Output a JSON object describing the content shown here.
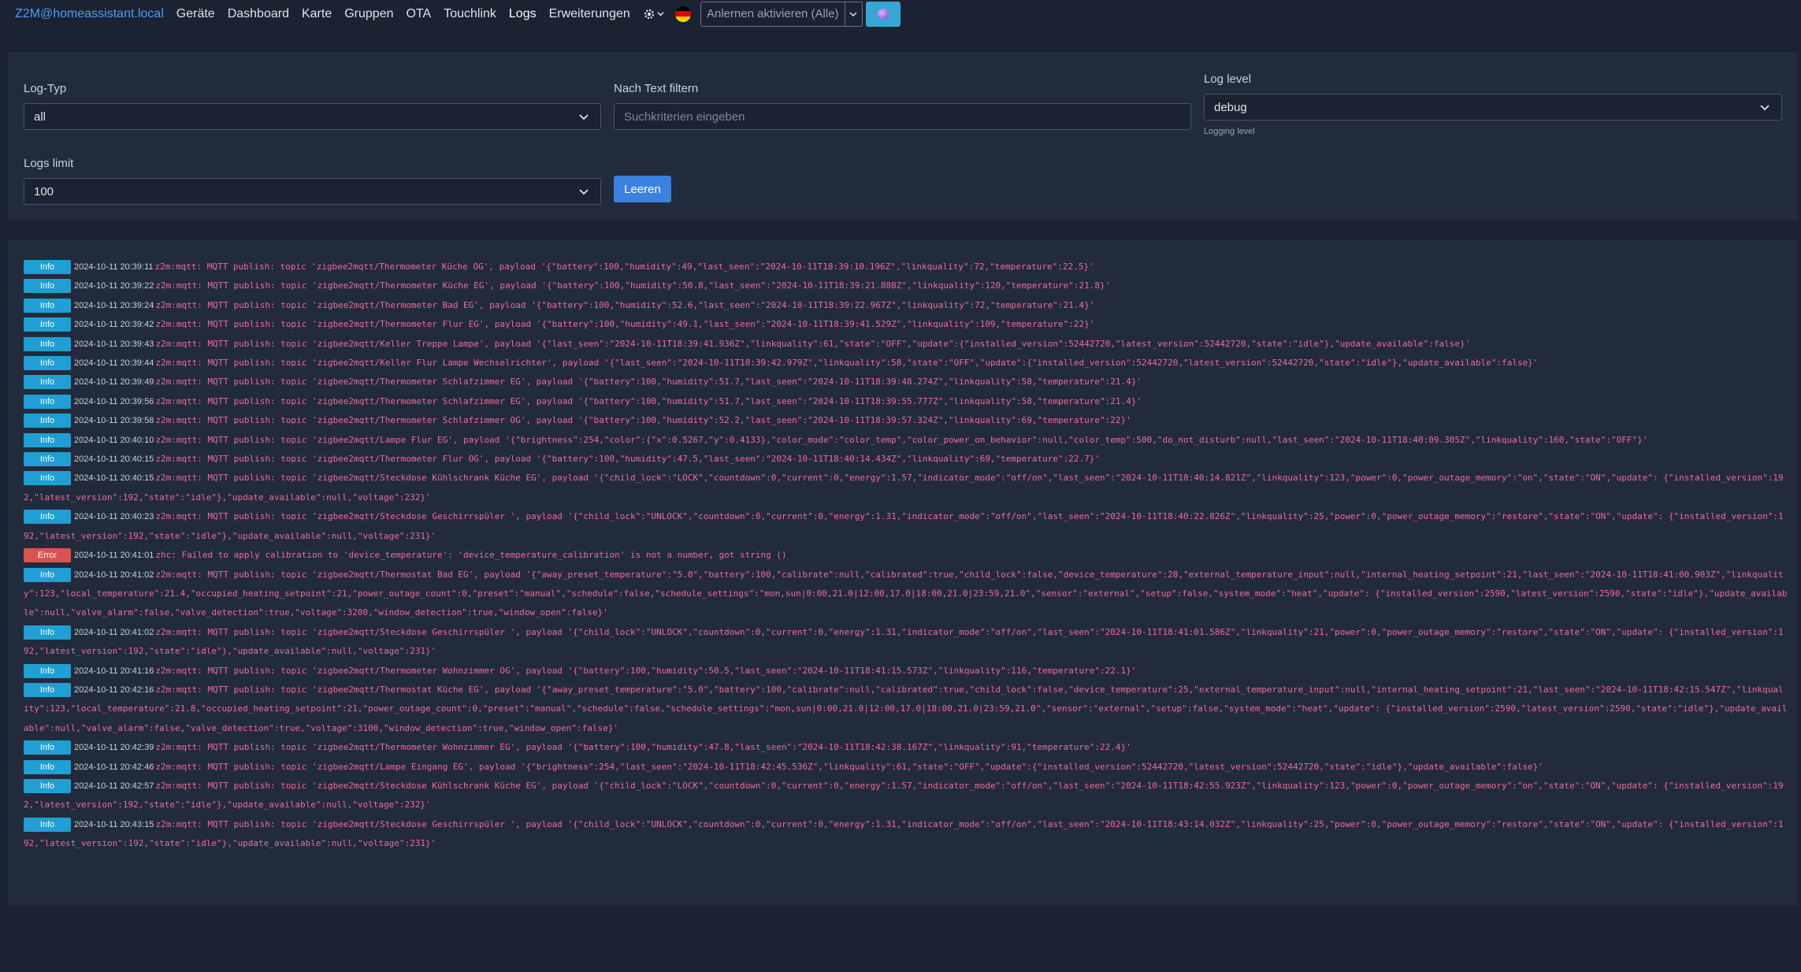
{
  "navbar": {
    "brand": "Z2M@homeassistant.local",
    "links": [
      "Geräte",
      "Dashboard",
      "Karte",
      "Gruppen",
      "OTA",
      "Touchlink",
      "Logs",
      "Erweiterungen"
    ],
    "active": "Logs",
    "pair_button": "Anlernen aktivieren (Alle)",
    "icons": [
      "gear-icon",
      "chevron-down-icon",
      "german-flag-icon",
      "theme-icon"
    ]
  },
  "filters": {
    "log_type_label": "Log-Typ",
    "log_type_value": "all",
    "text_filter_label": "Nach Text filtern",
    "text_filter_placeholder": "Suchkriterien eingeben",
    "log_level_label": "Log level",
    "log_level_value": "debug",
    "log_level_help": "Logging level",
    "logs_limit_label": "Logs limit",
    "logs_limit_value": "100",
    "clear_button": "Leeren"
  },
  "colors": {
    "info_badge": "#1f9fd4",
    "error_badge": "#d9534f",
    "log_text": "#f06a9d",
    "accent": "#3b82e0"
  },
  "logs": [
    {
      "level": "Info",
      "time": "2024-10-11 20:39:11",
      "message": "z2m:mqtt: MQTT publish: topic 'zigbee2mqtt/Thermometer Küche OG', payload '{\"battery\":100,\"humidity\":49,\"last_seen\":\"2024-10-11T18:39:10.196Z\",\"linkquality\":72,\"temperature\":22.5}'"
    },
    {
      "level": "Info",
      "time": "2024-10-11 20:39:22",
      "message": "z2m:mqtt: MQTT publish: topic 'zigbee2mqtt/Thermometer Küche EG', payload '{\"battery\":100,\"humidity\":50.8,\"last_seen\":\"2024-10-11T18:39:21.888Z\",\"linkquality\":120,\"temperature\":21.8}'"
    },
    {
      "level": "Info",
      "time": "2024-10-11 20:39:24",
      "message": "z2m:mqtt: MQTT publish: topic 'zigbee2mqtt/Thermometer Bad EG', payload '{\"battery\":100,\"humidity\":52.6,\"last_seen\":\"2024-10-11T18:39:22.967Z\",\"linkquality\":72,\"temperature\":21.4}'"
    },
    {
      "level": "Info",
      "time": "2024-10-11 20:39:42",
      "message": "z2m:mqtt: MQTT publish: topic 'zigbee2mqtt/Thermometer Flur EG', payload '{\"battery\":100,\"humidity\":49.1,\"last_seen\":\"2024-10-11T18:39:41.529Z\",\"linkquality\":109,\"temperature\":22}'"
    },
    {
      "level": "Info",
      "time": "2024-10-11 20:39:43",
      "message": "z2m:mqtt: MQTT publish: topic 'zigbee2mqtt/Keller Treppe Lampe', payload '{\"last_seen\":\"2024-10-11T18:39:41.936Z\",\"linkquality\":61,\"state\":\"OFF\",\"update\":{\"installed_version\":52442720,\"latest_version\":52442720,\"state\":\"idle\"},\"update_available\":false}'"
    },
    {
      "level": "Info",
      "time": "2024-10-11 20:39:44",
      "message": "z2m:mqtt: MQTT publish: topic 'zigbee2mqtt/Keller Flur Lampe Wechselrichter', payload '{\"last_seen\":\"2024-10-11T18:39:42.979Z\",\"linkquality\":58,\"state\":\"OFF\",\"update\":{\"installed_version\":52442720,\"latest_version\":52442720,\"state\":\"idle\"},\"update_available\":false}'"
    },
    {
      "level": "Info",
      "time": "2024-10-11 20:39:49",
      "message": "z2m:mqtt: MQTT publish: topic 'zigbee2mqtt/Thermometer Schlafzimmer EG', payload '{\"battery\":100,\"humidity\":51.7,\"last_seen\":\"2024-10-11T18:39:48.274Z\",\"linkquality\":58,\"temperature\":21.4}'"
    },
    {
      "level": "Info",
      "time": "2024-10-11 20:39:56",
      "message": "z2m:mqtt: MQTT publish: topic 'zigbee2mqtt/Thermometer Schlafzimmer EG', payload '{\"battery\":100,\"humidity\":51.7,\"last_seen\":\"2024-10-11T18:39:55.777Z\",\"linkquality\":58,\"temperature\":21.4}'"
    },
    {
      "level": "Info",
      "time": "2024-10-11 20:39:58",
      "message": "z2m:mqtt: MQTT publish: topic 'zigbee2mqtt/Thermometer Schlafzimmer OG', payload '{\"battery\":100,\"humidity\":52.2,\"last_seen\":\"2024-10-11T18:39:57.324Z\",\"linkquality\":69,\"temperature\":22}'"
    },
    {
      "level": "Info",
      "time": "2024-10-11 20:40:10",
      "message": "z2m:mqtt: MQTT publish: topic 'zigbee2mqtt/Lampe Flur EG', payload '{\"brightness\":254,\"color\":{\"x\":0.5267,\"y\":0.4133},\"color_mode\":\"color_temp\",\"color_power_on_behavior\":null,\"color_temp\":500,\"do_not_disturb\":null,\"last_seen\":\"2024-10-11T18:40:09.305Z\",\"linkquality\":160,\"state\":\"OFF\"}'"
    },
    {
      "level": "Info",
      "time": "2024-10-11 20:40:15",
      "message": "z2m:mqtt: MQTT publish: topic 'zigbee2mqtt/Thermometer Flur OG', payload '{\"battery\":100,\"humidity\":47.5,\"last_seen\":\"2024-10-11T18:40:14.434Z\",\"linkquality\":69,\"temperature\":22.7}'"
    },
    {
      "level": "Info",
      "time": "2024-10-11 20:40:15",
      "message": "z2m:mqtt: MQTT publish: topic 'zigbee2mqtt/Steckdose Kühlschrank Küche EG', payload '{\"child_lock\":\"LOCK\",\"countdown\":0,\"current\":0,\"energy\":1.57,\"indicator_mode\":\"off/on\",\"last_seen\":\"2024-10-11T18:40:14.821Z\",\"linkquality\":123,\"power\":0,\"power_outage_memory\":\"on\",\"state\":\"ON\",\"update\": {\"installed_version\":192,\"latest_version\":192,\"state\":\"idle\"},\"update_available\":null,\"voltage\":232}'"
    },
    {
      "level": "Info",
      "time": "2024-10-11 20:40:23",
      "message": "z2m:mqtt: MQTT publish: topic 'zigbee2mqtt/Steckdose Geschirrspüler ', payload '{\"child_lock\":\"UNLOCK\",\"countdown\":0,\"current\":0,\"energy\":1.31,\"indicator_mode\":\"off/on\",\"last_seen\":\"2024-10-11T18:40:22.826Z\",\"linkquality\":25,\"power\":0,\"power_outage_memory\":\"restore\",\"state\":\"ON\",\"update\": {\"installed_version\":192,\"latest_version\":192,\"state\":\"idle\"},\"update_available\":null,\"voltage\":231}'"
    },
    {
      "level": "Error",
      "time": "2024-10-11 20:41:01",
      "message": "zhc: Failed to apply calibration to 'device_temperature': 'device_temperature_calibration' is not a number, got string ()"
    },
    {
      "level": "Info",
      "time": "2024-10-11 20:41:02",
      "message": "z2m:mqtt: MQTT publish: topic 'zigbee2mqtt/Thermostat Bad EG', payload '{\"away_preset_temperature\":\"5.0\",\"battery\":100,\"calibrate\":null,\"calibrated\":true,\"child_lock\":false,\"device_temperature\":28,\"external_temperature_input\":null,\"internal_heating_setpoint\":21,\"last_seen\":\"2024-10-11T18:41:00.903Z\",\"linkquality\":123,\"local_temperature\":21.4,\"occupied_heating_setpoint\":21,\"power_outage_count\":0,\"preset\":\"manual\",\"schedule\":false,\"schedule_settings\":\"mon,sun|0:00,21.0|12:00,17.0|18:00,21.0|23:59,21.0\",\"sensor\":\"external\",\"setup\":false,\"system_mode\":\"heat\",\"update\": {\"installed_version\":2590,\"latest_version\":2590,\"state\":\"idle\"},\"update_available\":null,\"valve_alarm\":false,\"valve_detection\":true,\"voltage\":3200,\"window_detection\":true,\"window_open\":false}'"
    },
    {
      "level": "Info",
      "time": "2024-10-11 20:41:02",
      "message": "z2m:mqtt: MQTT publish: topic 'zigbee2mqtt/Steckdose Geschirrspüler ', payload '{\"child_lock\":\"UNLOCK\",\"countdown\":0,\"current\":0,\"energy\":1.31,\"indicator_mode\":\"off/on\",\"last_seen\":\"2024-10-11T18:41:01.586Z\",\"linkquality\":21,\"power\":0,\"power_outage_memory\":\"restore\",\"state\":\"ON\",\"update\": {\"installed_version\":192,\"latest_version\":192,\"state\":\"idle\"},\"update_available\":null,\"voltage\":231}'"
    },
    {
      "level": "Info",
      "time": "2024-10-11 20:41:16",
      "message": "z2m:mqtt: MQTT publish: topic 'zigbee2mqtt/Thermometer Wohnzimmer OG', payload '{\"battery\":100,\"humidity\":50.5,\"last_seen\":\"2024-10-11T18:41:15.573Z\",\"linkquality\":116,\"temperature\":22.1}'"
    },
    {
      "level": "Info",
      "time": "2024-10-11 20:42:16",
      "message": "z2m:mqtt: MQTT publish: topic 'zigbee2mqtt/Thermostat Küche EG', payload '{\"away_preset_temperature\":\"5.0\",\"battery\":100,\"calibrate\":null,\"calibrated\":true,\"child_lock\":false,\"device_temperature\":25,\"external_temperature_input\":null,\"internal_heating_setpoint\":21,\"last_seen\":\"2024-10-11T18:42:15.547Z\",\"linkquality\":123,\"local_temperature\":21.8,\"occupied_heating_setpoint\":21,\"power_outage_count\":0,\"preset\":\"manual\",\"schedule\":false,\"schedule_settings\":\"mon,sun|0:00,21.0|12:00,17.0|18:00,21.0|23:59,21.0\",\"sensor\":\"external\",\"setup\":false,\"system_mode\":\"heat\",\"update\": {\"installed_version\":2590,\"latest_version\":2590,\"state\":\"idle\"},\"update_available\":null,\"valve_alarm\":false,\"valve_detection\":true,\"voltage\":3100,\"window_detection\":true,\"window_open\":false}'"
    },
    {
      "level": "Info",
      "time": "2024-10-11 20:42:39",
      "message": "z2m:mqtt: MQTT publish: topic 'zigbee2mqtt/Thermometer Wohnzimmer EG', payload '{\"battery\":100,\"humidity\":47.8,\"last_seen\":\"2024-10-11T18:42:38.167Z\",\"linkquality\":91,\"temperature\":22.4}'"
    },
    {
      "level": "Info",
      "time": "2024-10-11 20:42:46",
      "message": "z2m:mqtt: MQTT publish: topic 'zigbee2mqtt/Lampe Eingang EG', payload '{\"brightness\":254,\"last_seen\":\"2024-10-11T18:42:45.536Z\",\"linkquality\":61,\"state\":\"OFF\",\"update\":{\"installed_version\":52442720,\"latest_version\":52442720,\"state\":\"idle\"},\"update_available\":false}'"
    },
    {
      "level": "Info",
      "time": "2024-10-11 20:42:57",
      "message": "z2m:mqtt: MQTT publish: topic 'zigbee2mqtt/Steckdose Kühlschrank Küche EG', payload '{\"child_lock\":\"LOCK\",\"countdown\":0,\"current\":0,\"energy\":1.57,\"indicator_mode\":\"off/on\",\"last_seen\":\"2024-10-11T18:42:55.923Z\",\"linkquality\":123,\"power\":0,\"power_outage_memory\":\"on\",\"state\":\"ON\",\"update\": {\"installed_version\":192,\"latest_version\":192,\"state\":\"idle\"},\"update_available\":null,\"voltage\":232}'"
    },
    {
      "level": "Info",
      "time": "2024-10-11 20:43:15",
      "message": "z2m:mqtt: MQTT publish: topic 'zigbee2mqtt/Steckdose Geschirrspüler ', payload '{\"child_lock\":\"UNLOCK\",\"countdown\":0,\"current\":0,\"energy\":1.31,\"indicator_mode\":\"off/on\",\"last_seen\":\"2024-10-11T18:43:14.032Z\",\"linkquality\":25,\"power\":0,\"power_outage_memory\":\"restore\",\"state\":\"ON\",\"update\": {\"installed_version\":192,\"latest_version\":192,\"state\":\"idle\"},\"update_available\":null,\"voltage\":231}'"
    }
  ]
}
